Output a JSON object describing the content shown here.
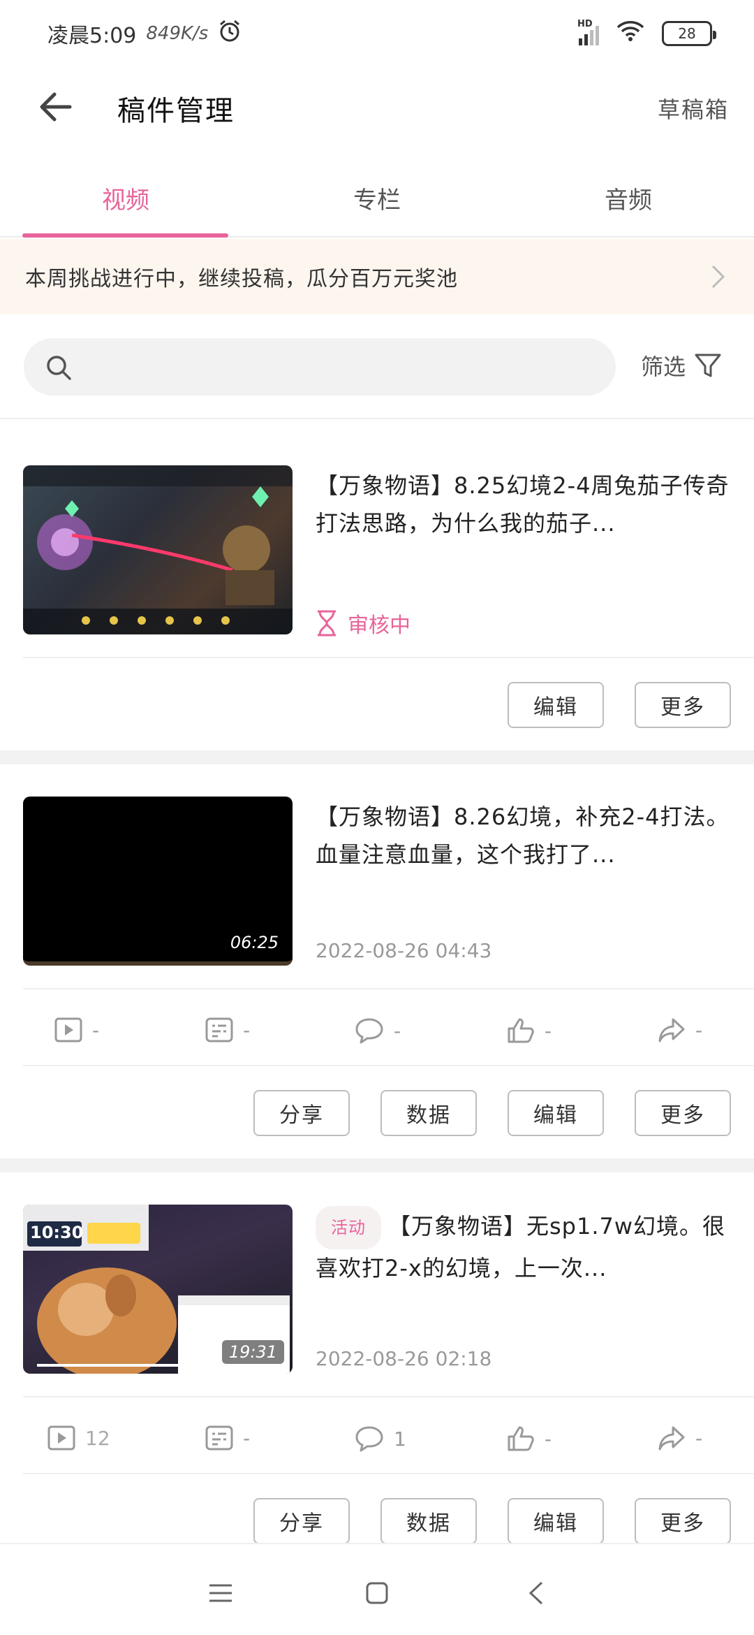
{
  "status_bar": {
    "time": "凌晨5:09",
    "network_speed": "849K/s",
    "network_type": "HD",
    "battery": "28",
    "icons": [
      "alarm-icon",
      "signal-icon",
      "wifi-icon",
      "battery-icon"
    ]
  },
  "header": {
    "title": "稿件管理",
    "draft_label": "草稿箱"
  },
  "tabs": [
    {
      "label": "视频",
      "active": true
    },
    {
      "label": "专栏",
      "active": false
    },
    {
      "label": "音频",
      "active": false
    }
  ],
  "banner": {
    "text": "本周挑战进行中，继续投稿，瓜分百万元奖池"
  },
  "search": {
    "placeholder": "",
    "filter_label": "筛选"
  },
  "items": [
    {
      "title": "【万象物语】8.25幻境2-4周兔茄子传奇打法思路，为什么我的茄子...",
      "status": "审核中",
      "buttons": {
        "edit": "编辑",
        "more": "更多"
      }
    },
    {
      "title": "【万象物语】8.26幻境，补充2-4打法。血量注意血量，这个我打了...",
      "duration": "06:25",
      "date": "2022-08-26 04:43",
      "stats": {
        "plays": "-",
        "danmaku": "-",
        "comments": "-",
        "likes": "-",
        "shares": "-"
      },
      "buttons": {
        "share": "分享",
        "data": "数据",
        "edit": "编辑",
        "more": "更多"
      }
    },
    {
      "tag": "活动",
      "title": "【万象物语】无sp1.7w幻境。很喜欢打2-x的幻境，上一次...",
      "duration": "19:31",
      "date": "2022-08-26 02:18",
      "thumb_clock": "10:30",
      "stats": {
        "plays": "12",
        "danmaku": "-",
        "comments": "1",
        "likes": "-",
        "shares": "-"
      },
      "buttons": {
        "share": "分享",
        "data": "数据",
        "edit": "编辑",
        "more": "更多"
      }
    }
  ],
  "colors": {
    "accent": "#e8649a",
    "banner_bg": "#fdf6ef",
    "muted": "#999999"
  }
}
